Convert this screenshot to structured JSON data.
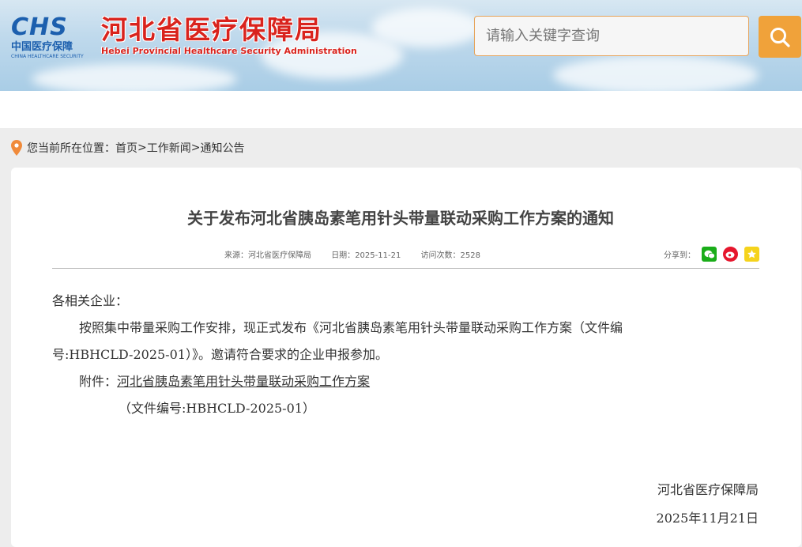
{
  "header": {
    "logo_mark": "CHS",
    "logo_cn": "中国医疗保障",
    "logo_en": "CHINA HEALTHCARE SECURITY",
    "site_title_cn": "河北省医疗保障局",
    "site_title_en": "Hebei Provincial Healthcare Security Administration",
    "search_placeholder": "请输入关键字查询",
    "search_icon": "search-icon"
  },
  "breadcrumb": {
    "prefix": "您当前所在位置：",
    "items": [
      "首页",
      "工作新闻",
      "通知公告"
    ],
    "separator": ">"
  },
  "article": {
    "title": "关于发布河北省胰岛素笔用针头带量联动采购工作方案的通知",
    "meta": {
      "source_label": "来源：",
      "source": "河北省医疗保障局",
      "date_label": "日期：",
      "date": "2025-11-21",
      "views_label": "访问次数：",
      "views": "2528"
    },
    "share_label": "分享到：",
    "share_icons": [
      "wechat-icon",
      "weibo-icon",
      "favorite-icon"
    ],
    "salutation": "各相关企业：",
    "para1_line1": "按照集中带量采购工作安排，现正式发布《河北省胰岛素笔用针头带量联动采购工作方案（文件编",
    "para1_line2": "号:HBHCLD-2025-01）》。邀请符合要求的企业申报参加。",
    "attachment_label": "附件：",
    "attachment_link": "河北省胰岛素笔用针头带量联动采购工作方案",
    "attachment_note": "（文件编号:HBHCLD-2025-01）",
    "signature": "河北省医疗保障局",
    "sign_date": "2025年11月21日"
  }
}
